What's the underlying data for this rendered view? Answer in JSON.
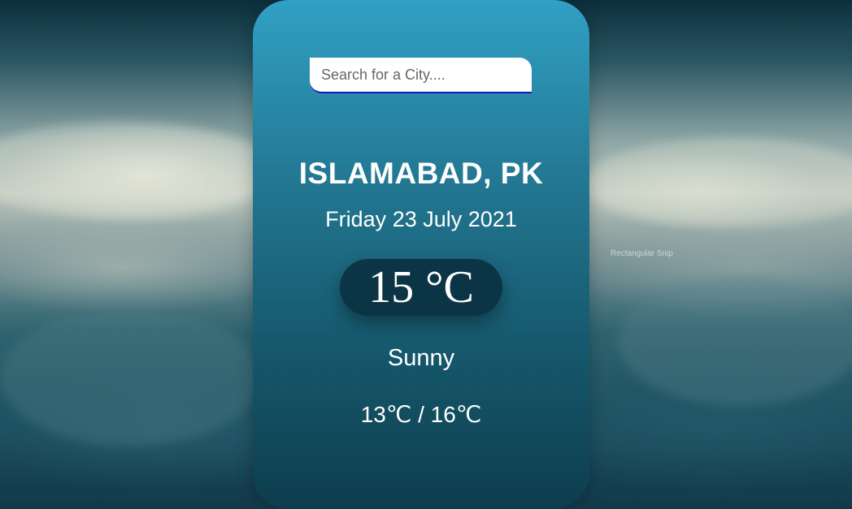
{
  "search": {
    "placeholder": "Search for a City....",
    "value": ""
  },
  "location": {
    "city": "ISLAMABAD, PK"
  },
  "date": {
    "text": "Friday 23 July 2021"
  },
  "weather": {
    "temperature": "15",
    "temp_unit": "°C",
    "condition": "Sunny",
    "min": "13",
    "max": "16",
    "unit": "℃",
    "range_separator": " / "
  },
  "overlay": {
    "snip_label": "Rectangular Snip"
  },
  "colors": {
    "card_top": "#31a0c4",
    "card_bottom": "#0d3d4d",
    "search_underline": "#1414c8",
    "text": "#ffffff"
  }
}
